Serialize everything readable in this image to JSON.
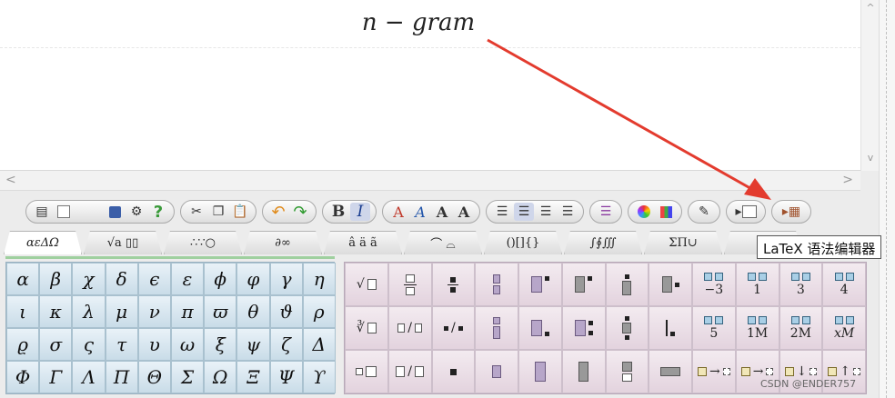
{
  "preview": {
    "formula": "n − gram"
  },
  "scroll": {
    "left_arrow": "<",
    "right_arrow": ">",
    "up_arrow": "^",
    "down_arrow": "v"
  },
  "toolbar": {
    "bold": "B",
    "italic": "I",
    "font_a1": "A",
    "font_a2": "A",
    "font_a3": "A",
    "font_a4": "A"
  },
  "tooltip": "LaTeX 语法编辑器",
  "tabs": [
    {
      "label": "αεΔΩ"
    },
    {
      "label": "√a ▯▯"
    },
    {
      "label": "∴∵○"
    },
    {
      "label": "∂∞"
    },
    {
      "label": "â ä ã"
    },
    {
      "label": "⌒ ⌓"
    },
    {
      "label": "()[]{}"
    },
    {
      "label": "∫∮∭"
    },
    {
      "label": "ΣΠ∪"
    },
    {
      "label": "▦"
    }
  ],
  "greek": [
    "α",
    "β",
    "χ",
    "δ",
    "ϵ",
    "ε",
    "ϕ",
    "φ",
    "γ",
    "η",
    "ι",
    "κ",
    "λ",
    "μ",
    "ν",
    "π",
    "ϖ",
    "θ",
    "ϑ",
    "ρ",
    "ϱ",
    "σ",
    "ς",
    "τ",
    "υ",
    "ω",
    "ξ",
    "ψ",
    "ζ",
    "Δ",
    "Φ",
    "Γ",
    "Λ",
    "Π",
    "Θ",
    "Σ",
    "Ω",
    "Ξ",
    "Ψ",
    "ϒ"
  ],
  "templates": {
    "labels": [
      "−3",
      "1",
      "3",
      "4",
      "5",
      "1M",
      "2M",
      "xM"
    ]
  },
  "watermark": "CSDN @ENDER757"
}
